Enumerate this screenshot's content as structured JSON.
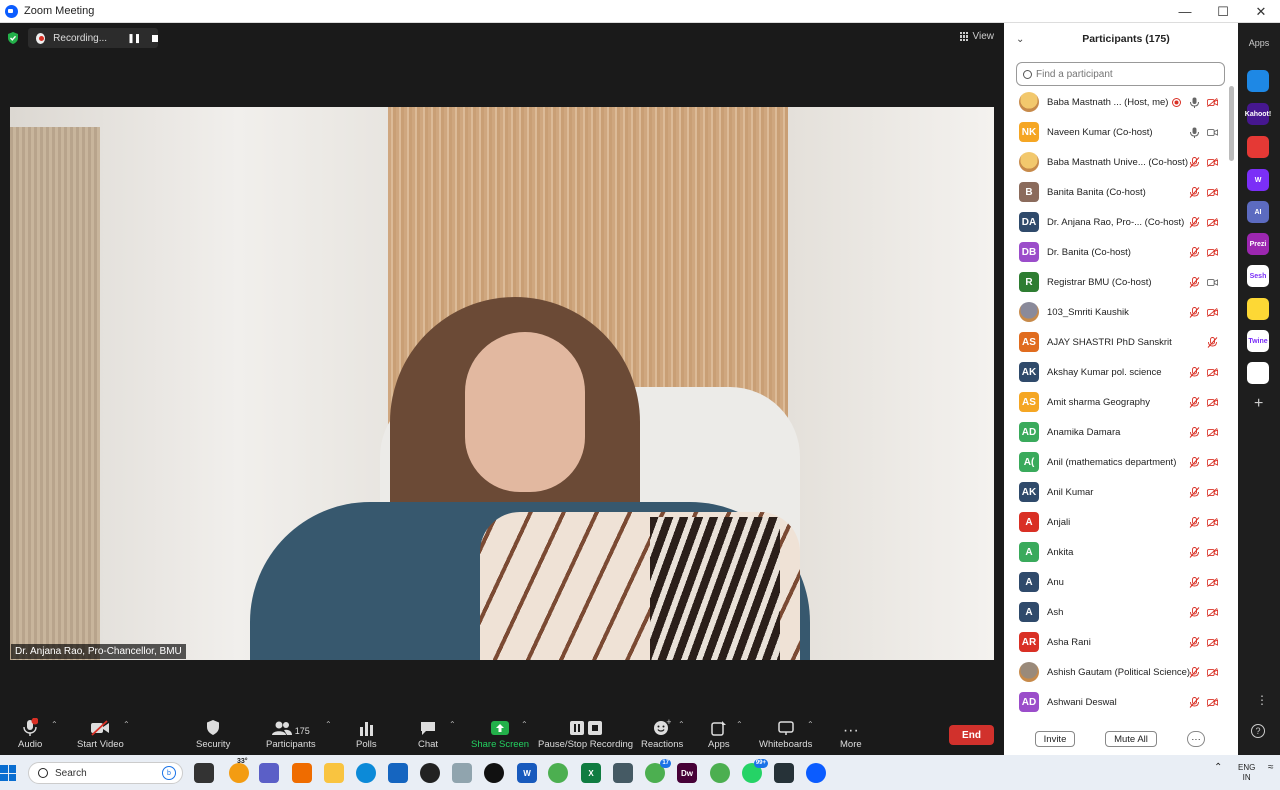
{
  "window": {
    "title": "Zoom Meeting",
    "controls": [
      "—",
      "☐",
      "✕"
    ]
  },
  "recording": {
    "label": "Recording..."
  },
  "view": {
    "label": "View"
  },
  "video": {
    "speaker_name": "Dr. Anjana Rao, Pro-Chancellor, BMU"
  },
  "toolbar": {
    "audio": "Audio",
    "audio_badge": "1",
    "start_video": "Start Video",
    "security": "Security",
    "participants": "Participants",
    "participants_count": "175",
    "polls": "Polls",
    "chat": "Chat",
    "share_screen": "Share Screen",
    "pause_stop_recording": "Pause/Stop Recording",
    "reactions": "Reactions",
    "apps": "Apps",
    "whiteboards": "Whiteboards",
    "more": "More",
    "end": "End"
  },
  "panel": {
    "title": "Participants (175)",
    "search_placeholder": "Find a participant",
    "invite": "Invite",
    "mute_all": "Mute All",
    "more": "···",
    "participants": [
      {
        "initials": "",
        "name": "Baba Mastnath ...  (Host, me)",
        "color": "#f2c86d",
        "photo": true,
        "mic": "on",
        "rec": true,
        "video": "off"
      },
      {
        "initials": "NK",
        "name": "Naveen Kumar (Co-host)",
        "color": "#f5a623",
        "photo": false,
        "mic": "on",
        "rec": false,
        "video": "on"
      },
      {
        "initials": "",
        "name": "Baba Mastnath Unive...  (Co-host)",
        "color": "#f2c86d",
        "photo": true,
        "mic": "off",
        "rec": false,
        "video": "off"
      },
      {
        "initials": "B",
        "name": "Banita Banita (Co-host)",
        "color": "#8b6b5c",
        "photo": false,
        "mic": "off",
        "rec": false,
        "video": "off"
      },
      {
        "initials": "DA",
        "name": "Dr. Anjana Rao, Pro-...  (Co-host)",
        "color": "#2f4a6b",
        "photo": false,
        "mic": "off",
        "rec": false,
        "video": "off"
      },
      {
        "initials": "DB",
        "name": "Dr. Banita (Co-host)",
        "color": "#9b4dca",
        "photo": false,
        "mic": "off",
        "rec": false,
        "video": "off"
      },
      {
        "initials": "R",
        "name": "Registrar BMU (Co-host)",
        "color": "#2e7d32",
        "photo": false,
        "mic": "off",
        "rec": false,
        "video": "on"
      },
      {
        "initials": "",
        "name": "103_Smriti Kaushik",
        "color": "#8a8a9a",
        "photo": true,
        "mic": "off",
        "rec": false,
        "video": "off"
      },
      {
        "initials": "AS",
        "name": "AJAY SHASTRI PhD Sanskrit",
        "color": "#e06c1f",
        "photo": false,
        "mic": "off",
        "rec": false,
        "video": "none"
      },
      {
        "initials": "AK",
        "name": "Akshay Kumar pol. science",
        "color": "#2f4a6b",
        "photo": false,
        "mic": "off",
        "rec": false,
        "video": "off"
      },
      {
        "initials": "AS",
        "name": "Amit sharma Geography",
        "color": "#f5a623",
        "photo": false,
        "mic": "off",
        "rec": false,
        "video": "off"
      },
      {
        "initials": "AD",
        "name": "Anamika Damara",
        "color": "#3aaa5c",
        "photo": false,
        "mic": "off",
        "rec": false,
        "video": "off"
      },
      {
        "initials": "A(",
        "name": "Anil (mathematics department)",
        "color": "#3aaa5c",
        "photo": false,
        "mic": "off",
        "rec": false,
        "video": "off"
      },
      {
        "initials": "AK",
        "name": "Anil Kumar",
        "color": "#2f4a6b",
        "photo": false,
        "mic": "off",
        "rec": false,
        "video": "off"
      },
      {
        "initials": "A",
        "name": "Anjali",
        "color": "#d93025",
        "photo": false,
        "mic": "off",
        "rec": false,
        "video": "off"
      },
      {
        "initials": "A",
        "name": "Ankita",
        "color": "#3aaa5c",
        "photo": false,
        "mic": "off",
        "rec": false,
        "video": "off"
      },
      {
        "initials": "A",
        "name": "Anu",
        "color": "#2f4a6b",
        "photo": false,
        "mic": "off",
        "rec": false,
        "video": "off"
      },
      {
        "initials": "A",
        "name": "Ash",
        "color": "#2f4a6b",
        "photo": false,
        "mic": "off",
        "rec": false,
        "video": "off"
      },
      {
        "initials": "AR",
        "name": "Asha Rani",
        "color": "#d93025",
        "photo": false,
        "mic": "off",
        "rec": false,
        "video": "off"
      },
      {
        "initials": "",
        "name": "Ashish Gautam (Political Science)",
        "color": "#9a8a7a",
        "photo": true,
        "mic": "off",
        "rec": false,
        "video": "off"
      },
      {
        "initials": "AD",
        "name": "Ashwani Deswal",
        "color": "#9b4dca",
        "photo": false,
        "mic": "off",
        "rec": false,
        "video": "off"
      }
    ]
  },
  "apps_sidebar": {
    "title": "Apps",
    "items": [
      {
        "icon": "arrow-app-icon",
        "label": "",
        "color": "#1e88e5"
      },
      {
        "icon": "kahoot-icon",
        "label": "Kahoot!",
        "color": "#46178f"
      },
      {
        "icon": "red-app-icon",
        "label": "",
        "color": "#e53935"
      },
      {
        "icon": "w-app-icon",
        "label": "W",
        "color": "#7b2ff7"
      },
      {
        "icon": "ai-app-icon",
        "label": "AI",
        "color": "#5c6bc0"
      },
      {
        "icon": "prezi-icon",
        "label": "Prezi",
        "color": "#9c27b0"
      },
      {
        "icon": "sesh-icon",
        "label": "Sesh",
        "color": "#ffffff"
      },
      {
        "icon": "emoji-app-icon",
        "label": "",
        "color": "#fdd835"
      },
      {
        "icon": "twine-icon",
        "label": "Twine",
        "color": "#ffffff"
      },
      {
        "icon": "grid-app-icon",
        "label": "",
        "color": "#ffffff"
      }
    ]
  },
  "taskbar": {
    "search_label": "Search",
    "weather": "33°",
    "badge_chrome": "17",
    "badge_whatsapp": "99+",
    "lang_1": "ENG",
    "lang_2": "IN"
  }
}
